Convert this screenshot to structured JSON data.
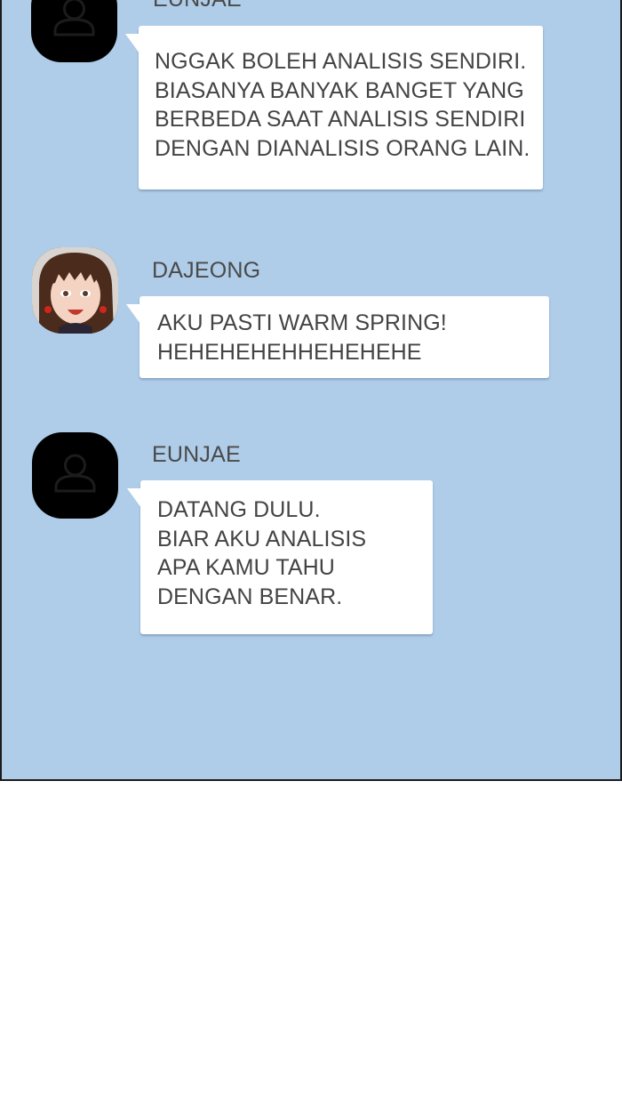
{
  "messages": [
    {
      "sender": "EUNJAE",
      "avatar": "default-user-icon",
      "lines": [
        "NGGAK BOLEH ANALISIS SENDIRI.",
        "BIASANYA BANYAK BANGET YANG",
        "BERBEDA SAAT ANALISIS SENDIRI",
        "DENGAN DIANALISIS ORANG LAIN."
      ]
    },
    {
      "sender": "DAJEONG",
      "avatar": "dajeong-portrait",
      "lines": [
        "AKU PASTI WARM SPRING!",
        "HEHEHEHEHHEHEHEHE"
      ]
    },
    {
      "sender": "EUNJAE",
      "avatar": "default-user-icon",
      "lines": [
        "DATANG DULU.",
        "BIAR AKU ANALISIS",
        "APA KAMU TAHU",
        "DENGAN BENAR."
      ]
    }
  ],
  "colors": {
    "chat_background": "#afcde8",
    "bubble": "#ffffff",
    "text": "#444444",
    "page": "#ffffff"
  }
}
